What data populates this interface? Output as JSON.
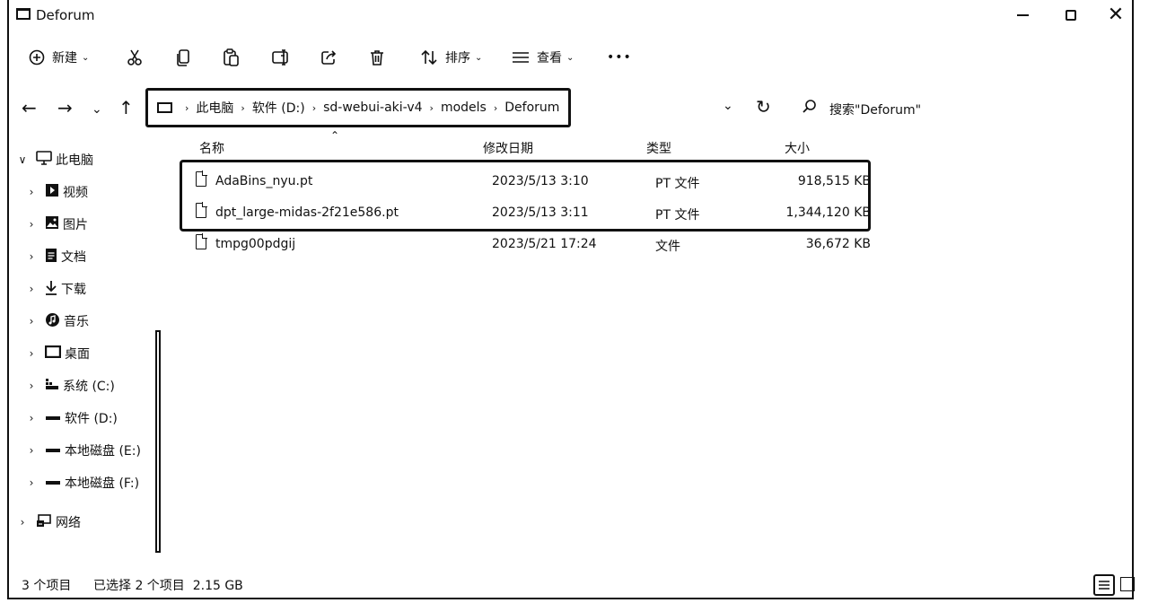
{
  "window": {
    "title": "Deforum"
  },
  "toolbar": {
    "new_label": "新建",
    "sort_label": "排序",
    "view_label": "查看",
    "more_label": "•••"
  },
  "address": {
    "crumbs": [
      "此电脑",
      "软件 (D:)",
      "sd-webui-aki-v4",
      "models",
      "Deforum"
    ],
    "search_placeholder": "搜索\"Deforum\""
  },
  "sidebar": {
    "items": [
      {
        "label": "此电脑",
        "icon": "computer-icon",
        "chev": "∨"
      },
      {
        "label": "视频",
        "icon": "video-icon",
        "chev": "›"
      },
      {
        "label": "图片",
        "icon": "image-icon",
        "chev": "›"
      },
      {
        "label": "文档",
        "icon": "document-icon",
        "chev": "›"
      },
      {
        "label": "下载",
        "icon": "download-icon",
        "chev": "›"
      },
      {
        "label": "音乐",
        "icon": "music-icon",
        "chev": "›"
      },
      {
        "label": "桌面",
        "icon": "desktop-icon",
        "chev": "›"
      },
      {
        "label": "系统 (C:)",
        "icon": "drive-icon",
        "chev": "›"
      },
      {
        "label": "软件 (D:)",
        "icon": "drive-icon",
        "chev": "›"
      },
      {
        "label": "本地磁盘 (E:)",
        "icon": "drive-icon",
        "chev": "›"
      },
      {
        "label": "本地磁盘 (F:)",
        "icon": "drive-icon",
        "chev": "›"
      },
      {
        "label": "网络",
        "icon": "network-icon",
        "chev": "›"
      }
    ]
  },
  "columns": {
    "name": "名称",
    "modified": "修改日期",
    "type": "类型",
    "size": "大小"
  },
  "files": [
    {
      "name": "AdaBins_nyu.pt",
      "modified": "2023/5/13 3:10",
      "type": "PT 文件",
      "size": "918,515 KB"
    },
    {
      "name": "dpt_large-midas-2f21e586.pt",
      "modified": "2023/5/13 3:11",
      "type": "PT 文件",
      "size": "1,344,120 KB"
    },
    {
      "name": "tmpg00pdgij",
      "modified": "2023/5/21 17:24",
      "type": "文件",
      "size": "36,672 KB"
    }
  ],
  "status": {
    "item_count": "3 个项目",
    "selected": "已选择 2 个项目  2.15 GB"
  }
}
